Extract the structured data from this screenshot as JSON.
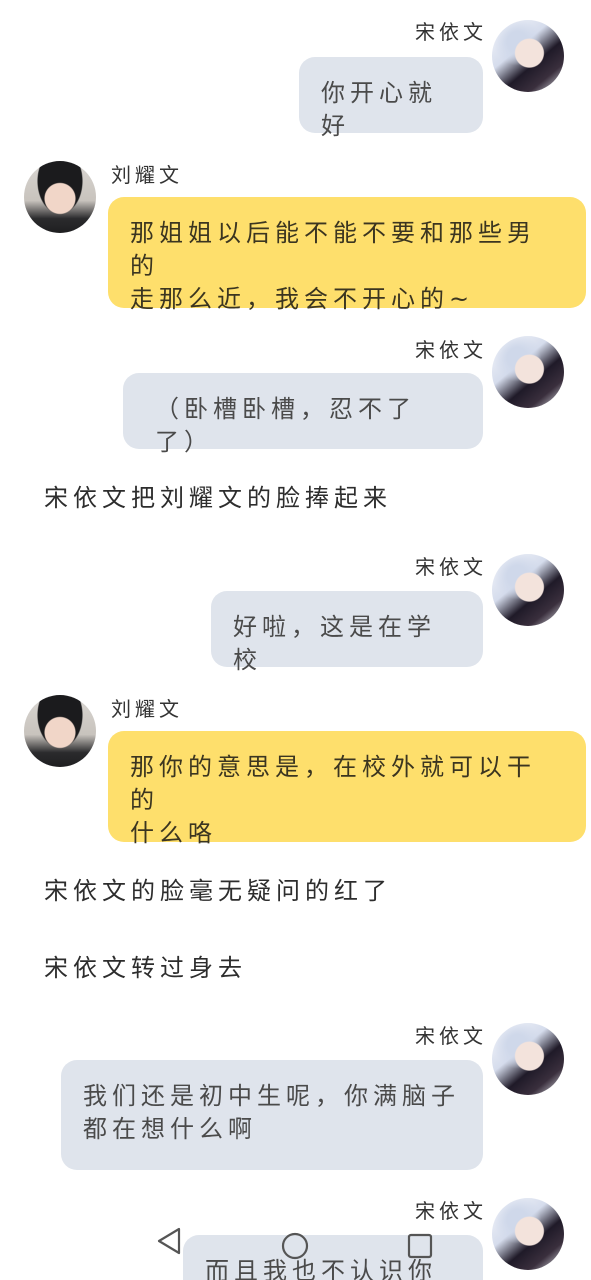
{
  "conversation": [
    {
      "type": "message",
      "side": "right",
      "sender": "宋依文",
      "bubble_color": "#dfe4ec",
      "lines": [
        "你开心就好"
      ]
    },
    {
      "type": "message",
      "side": "left",
      "sender": "刘耀文",
      "bubble_color": "#fedf6c",
      "lines": [
        "那姐姐以后能不能不要和那些男的",
        "走那么近，我会不开心的~"
      ]
    },
    {
      "type": "message",
      "side": "right",
      "sender": "宋依文",
      "bubble_color": "#dfe4ec",
      "lines": [
        "（卧槽卧槽，忍不了了）"
      ]
    },
    {
      "type": "narration",
      "text": "宋依文把刘耀文的脸捧起来"
    },
    {
      "type": "message",
      "side": "right",
      "sender": "宋依文",
      "bubble_color": "#dfe4ec",
      "lines": [
        "好啦，这是在学校"
      ]
    },
    {
      "type": "message",
      "side": "left",
      "sender": "刘耀文",
      "bubble_color": "#fedf6c",
      "lines": [
        "那你的意思是，在校外就可以干的",
        "什么咯"
      ]
    },
    {
      "type": "narration",
      "text": "宋依文的脸毫无疑问的红了"
    },
    {
      "type": "narration",
      "text": "宋依文转过身去"
    },
    {
      "type": "message",
      "side": "right",
      "sender": "宋依文",
      "bubble_color": "#dfe4ec",
      "lines": [
        "我们还是初中生呢，你满脑子",
        "都在想什么啊"
      ]
    },
    {
      "type": "message",
      "side": "right",
      "sender": "宋依文",
      "bubble_color": "#dfe4ec",
      "lines": [
        "而且我也不认识你啊"
      ]
    }
  ],
  "icons": {
    "back": "triangle-back-icon",
    "home": "circle-home-icon",
    "recents": "square-recents-icon"
  }
}
